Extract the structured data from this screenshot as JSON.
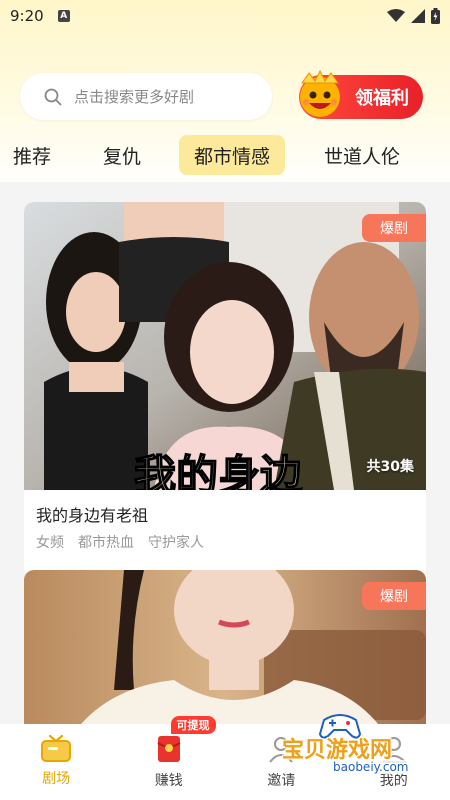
{
  "status": {
    "time": "9:20",
    "badge": "A"
  },
  "search": {
    "placeholder": "点击搜索更多好剧"
  },
  "welfare": {
    "label": "领福利"
  },
  "tabs": [
    {
      "label": "推荐"
    },
    {
      "label": "复仇"
    },
    {
      "label": "都市情感"
    },
    {
      "label": "世道人伦"
    }
  ],
  "cards": [
    {
      "badge": "爆剧",
      "episodes": "共30集",
      "title": "我的身边有老祖",
      "tags": [
        "女频",
        "都市热血",
        "守护家人"
      ]
    },
    {
      "badge": "爆剧"
    }
  ],
  "nav": {
    "items": [
      {
        "label": "剧场"
      },
      {
        "label": "赚钱"
      },
      {
        "label": "邀请"
      },
      {
        "label": "我的"
      }
    ],
    "cash_badge": "可提现"
  },
  "watermark": {
    "text": "宝贝游戏网",
    "url": "baobeiy.com"
  },
  "colors": {
    "accent": "#e8a600",
    "hot_badge": "#f7765a",
    "active_tab_bg": "#fde99a"
  }
}
